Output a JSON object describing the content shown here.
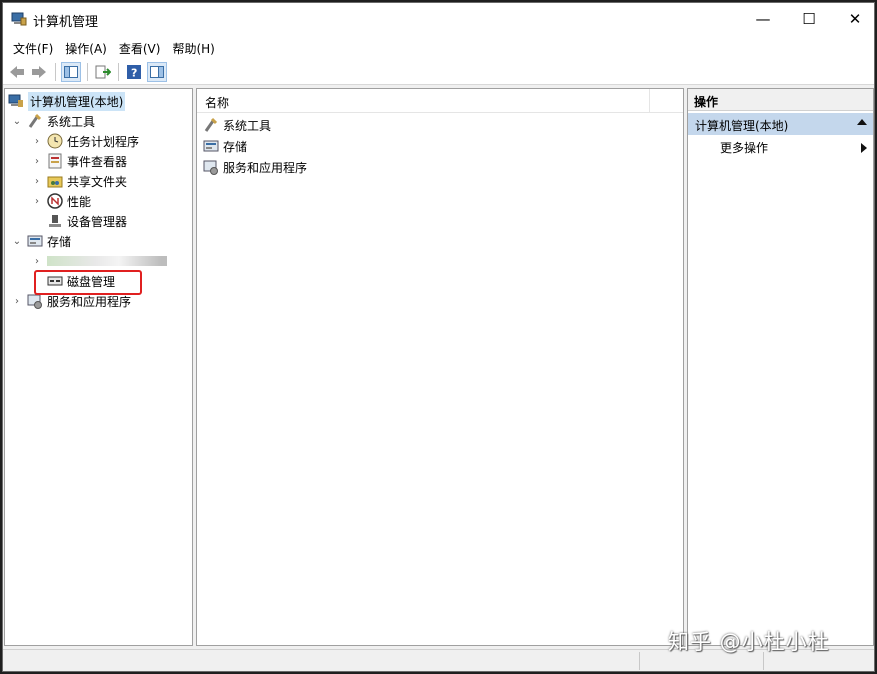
{
  "window": {
    "title": "计算机管理",
    "controls": {
      "minimize": "—",
      "maximize": "☐",
      "close": "✕"
    }
  },
  "menu": [
    "文件(F)",
    "操作(A)",
    "查看(V)",
    "帮助(H)"
  ],
  "tree": {
    "root": "计算机管理(本地)",
    "system_tools": "系统工具",
    "task_scheduler": "任务计划程序",
    "event_viewer": "事件查看器",
    "shared_folders": "共享文件夹",
    "performance": "性能",
    "device_manager": "设备管理器",
    "storage": "存储",
    "disk_management": "磁盘管理",
    "services_apps": "服务和应用程序"
  },
  "center": {
    "column_name": "名称",
    "items": [
      "系统工具",
      "存储",
      "服务和应用程序"
    ]
  },
  "actions": {
    "header": "操作",
    "section": "计算机管理(本地)",
    "more": "更多操作"
  },
  "watermark": "知乎 @小杜小杜",
  "colors": {
    "selection": "#cce4f7",
    "action_section": "#c4d7ec",
    "highlight": "#e02020"
  }
}
